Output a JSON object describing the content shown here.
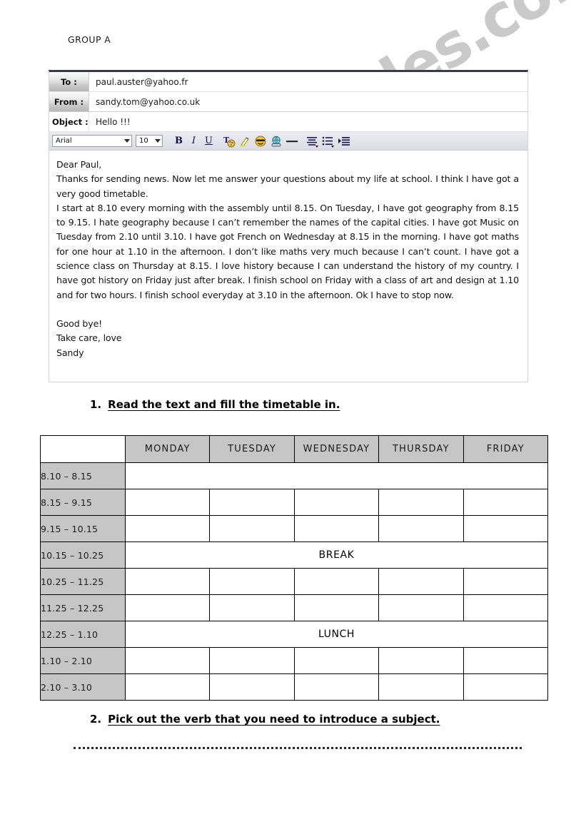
{
  "page": {
    "group_label": "GROUP A",
    "watermark": "ESLprintables.com"
  },
  "mail": {
    "fields": [
      {
        "label": "To :",
        "value": "paul.auster@yahoo.fr"
      },
      {
        "label": "From :",
        "value": "sandy.tom@yahoo.co.uk"
      },
      {
        "label": "Object :",
        "value": "Hello !!!"
      }
    ],
    "toolbar": {
      "font_name": "Arial",
      "font_size": "10",
      "bold_label": "B",
      "italic_label": "I",
      "underline_label": "U",
      "icons": [
        "text-color-icon",
        "highlighter-icon",
        "emoticon-icon",
        "insert-link-icon",
        "horizontal-rule-icon",
        "align-icon",
        "bullet-list-icon",
        "indent-icon"
      ]
    },
    "body": {
      "greeting": "Dear Paul,",
      "para1": "Thanks for sending news. Now let me answer your questions about my life at school. I think I have got a very good timetable.",
      "para2": "I start at 8.10 every morning with the assembly until 8.15. On Tuesday, I have got geography from 8.15 to 9.15. I hate geography because I can’t remember the names of the capital cities. I have got Music on Tuesday from 2.10 until 3.10. I have got French on Wednesday at 8.15 in the morning. I have got maths for one hour at 1.10 in the afternoon. I don’t like maths very much because I can’t count. I have got a science class on Thursday at 8.15. I love history because I can understand the history of my country. I have got history on Friday just after break. I finish school on Friday with a class of art and design at 1.10 and for two hours. I finish school everyday at 3.10 in the afternoon. Ok I have to stop now.",
      "closing1": "Good bye!",
      "closing2": "Take care, love",
      "signature": "Sandy"
    }
  },
  "exercises": [
    {
      "number": "1.",
      "text": "Read the text and fill the timetable in."
    },
    {
      "number": "2.",
      "text": "Pick out the verb that you need to introduce a subject."
    }
  ],
  "timetable": {
    "corner_header": "",
    "days": [
      "MONDAY",
      "TUESDAY",
      "WEDNESDAY",
      "THURSDAY",
      "FRIDAY"
    ],
    "rows": [
      {
        "time": "8.10 – 8.15",
        "merged": true,
        "merged_text": ""
      },
      {
        "time": "8.15 – 9.15",
        "merged": false,
        "cells": [
          "",
          "",
          "",
          "",
          ""
        ]
      },
      {
        "time": "9.15 – 10.15",
        "merged": false,
        "cells": [
          "",
          "",
          "",
          "",
          ""
        ]
      },
      {
        "time": "10.15 – 10.25",
        "merged": true,
        "merged_text": "BREAK"
      },
      {
        "time": "10.25 – 11.25",
        "merged": false,
        "cells": [
          "",
          "",
          "",
          "",
          ""
        ]
      },
      {
        "time": "11.25 – 12.25",
        "merged": false,
        "cells": [
          "",
          "",
          "",
          "",
          ""
        ]
      },
      {
        "time": "12.25 – 1.10",
        "merged": true,
        "merged_text": "LUNCH"
      },
      {
        "time": "1.10 – 2.10",
        "merged": false,
        "cells": [
          "",
          "",
          "",
          "",
          ""
        ]
      },
      {
        "time": "2.10 – 3.10",
        "merged": false,
        "cells": [
          "",
          "",
          "",
          "",
          ""
        ]
      }
    ]
  },
  "answer_line": {
    "dots": ""
  },
  "colors": {
    "header_gray": "#c6c6c6",
    "toolbar_bg": "#e4e4ec",
    "panel_top_border": "#3a3a46",
    "watermark": "#c9c9c9"
  }
}
